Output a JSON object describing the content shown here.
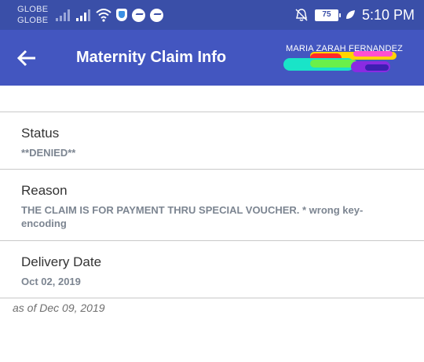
{
  "status_bar": {
    "carrier_1": "GLOBE",
    "carrier_2": "GLOBE",
    "battery": "75",
    "time": "5:10 PM"
  },
  "app_bar": {
    "title": "Maternity Claim Info",
    "user_name": "MARIA ZARAH FERNANDEZ"
  },
  "details": [
    {
      "label": "Status",
      "value": "**DENIED**"
    },
    {
      "label": "Reason",
      "value": "THE CLAIM IS FOR PAYMENT THRU SPECIAL VOUCHER. * wrong key-encoding"
    },
    {
      "label": "Delivery Date",
      "value": "Oct 02, 2019"
    }
  ],
  "footer": {
    "as_of": "as of Dec 09, 2019"
  },
  "colors": {
    "status_bar": "#3a4fa8",
    "app_bar": "#4356c0",
    "value_text": "#7c8591"
  }
}
